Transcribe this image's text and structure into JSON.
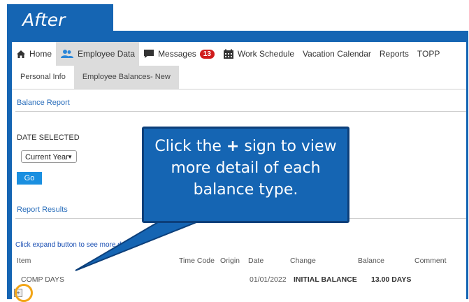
{
  "banner": {
    "title": "After"
  },
  "nav": {
    "items": [
      {
        "label": "Home"
      },
      {
        "label": "Employee Data"
      },
      {
        "label": "Messages",
        "badge": "13"
      },
      {
        "label": "Work Schedule"
      },
      {
        "label": "Vacation Calendar"
      },
      {
        "label": "Reports"
      },
      {
        "label": "TOPP"
      }
    ]
  },
  "subtabs": [
    {
      "label": "Personal Info"
    },
    {
      "label": "Employee Balances- New"
    }
  ],
  "balance_report": {
    "title": "Balance Report",
    "date_label": "DATE SELECTED",
    "select_value": "Current Year",
    "go_label": "Go"
  },
  "results": {
    "title": "Report Results",
    "hint": "Click expand button to see more d",
    "columns": [
      "Item",
      "Time Code",
      "Origin",
      "Date",
      "Change",
      "Balance",
      "Comment"
    ],
    "row": {
      "item": "COMP DAYS",
      "time_code": "",
      "origin": "",
      "date": "01/01/2022",
      "change": "INITIAL BALANCE",
      "balance": "13.00 DAYS",
      "comment": ""
    }
  },
  "callout": {
    "text_before": "Click the ",
    "plus": "+",
    "text_after": " sign to view more detail of each balance type."
  },
  "colors": {
    "accent": "#1565b3",
    "callout_border": "#0c3f7a",
    "highlight_ring": "#f2a516",
    "badge": "#d01c1c"
  }
}
